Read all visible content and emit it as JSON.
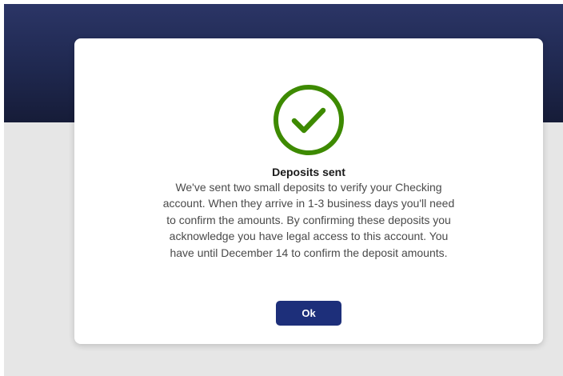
{
  "dialog": {
    "title": "Deposits sent",
    "message": "We've sent two small deposits to verify your Checking account. When they arrive in 1-3 business days you'll need to confirm the amounts. By confirming these deposits you acknowledge you have legal access to this account. You have until December 14 to confirm the deposit amounts.",
    "ok_label": "Ok",
    "icon": "check-circle-icon"
  },
  "colors": {
    "header_dark": "#1f284f",
    "background": "#e6e6e6",
    "success_green": "#3d8a00",
    "primary_button": "#1d2f7a"
  }
}
